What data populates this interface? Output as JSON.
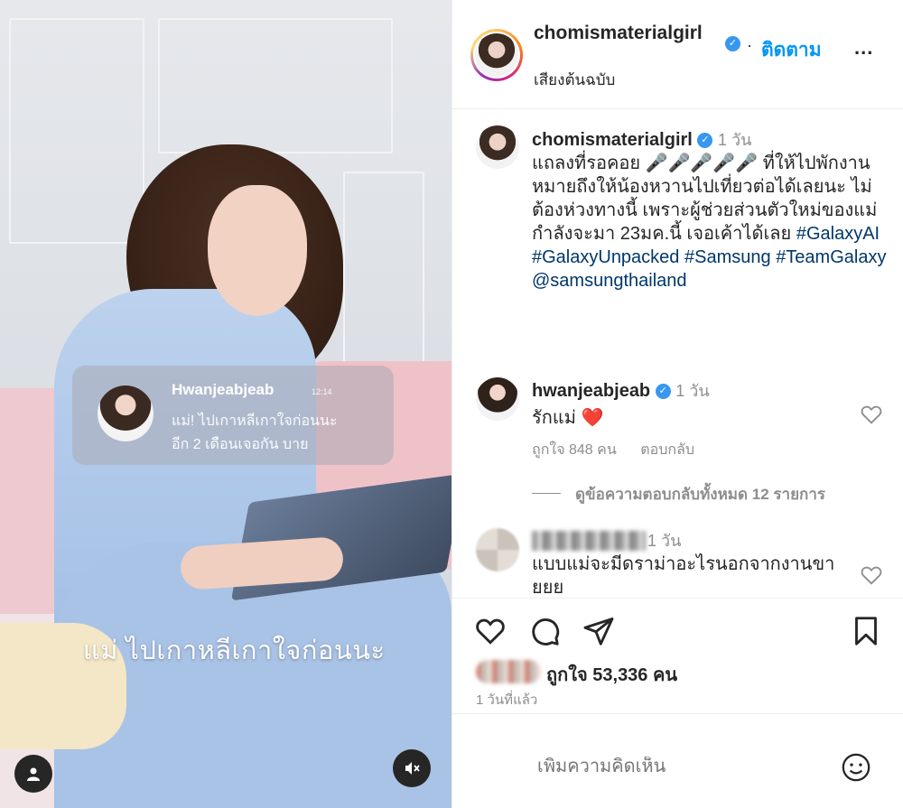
{
  "media": {
    "notification": {
      "name": "Hwanjeabjeab",
      "time": "12:14",
      "line1": "แม่! ไปเกาหลีเกาใจก่อนนะ",
      "line2": "อีก 2 เดือนเจอกัน บาย"
    },
    "caption": "แม่ ไปเกาหลีเกาใจก่อนนะ",
    "icons": {
      "profile": "user-icon",
      "sound": "sound-muted-icon"
    }
  },
  "header": {
    "username": "chomismaterialgirl",
    "follow": "ติดตาม",
    "audio": "เสียงต้นฉบับ",
    "dot": "·",
    "more": "..."
  },
  "caption": {
    "username": "chomismaterialgirl",
    "time": "1 วัน",
    "text": "แถลงที่รอคอย 🎤🎤🎤🎤🎤 ที่ให้ไปพักงาน หมายถึงให้น้องหวานไปเที่ยวต่อได้เลยนะ ไม่ต้องห่วงทางนี้ เพราะผู้ช่วยส่วนตัวใหม่ของแม่กำลังจะมา 23มค.นี้ เจอเค้าได้เลย",
    "tags": [
      "#GalaxyAI",
      "#GalaxyUnpacked",
      "#Samsung",
      "#TeamGalaxy",
      "@samsungthailand"
    ]
  },
  "comments": [
    {
      "username": "hwanjeabjeab",
      "time": "1 วัน",
      "text": "รักแม่",
      "emoji": "❤️",
      "likes": "ถูกใจ 848 คน",
      "reply": "ตอบกลับ",
      "view_replies": "ดูข้อความตอบกลับทั้งหมด 12 รายการ"
    },
    {
      "time": "1 วัน",
      "text": "แบบแม่จะมีดราม่าอะไรนอกจากงานขายยย"
    }
  ],
  "actions": {
    "likes": "ถูกใจ 53,336 คน",
    "ago": "1 วันที่แล้ว",
    "comment_placeholder": "เพิ่มความคิดเห็น"
  },
  "colors": {
    "link": "#0095f6",
    "hashtag": "#00376b",
    "verified": "#3897f0",
    "muted": "#8e8e8e"
  }
}
